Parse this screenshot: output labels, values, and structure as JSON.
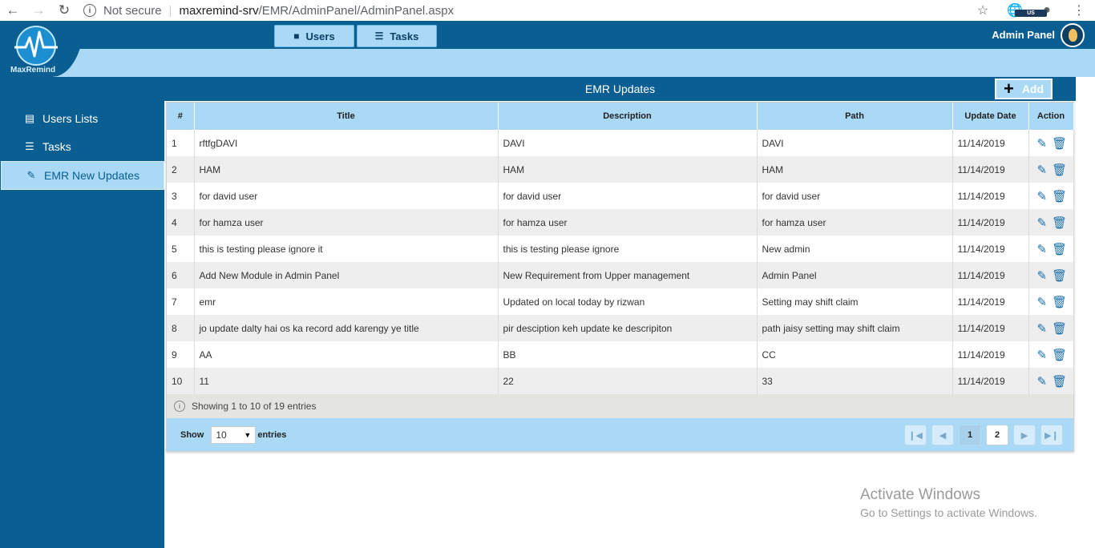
{
  "browser": {
    "security": "Not secure",
    "url_host": "maxremind-srv",
    "url_path": "/EMR/AdminPanel/AdminPanel.aspx",
    "ext_badge": "US"
  },
  "header": {
    "logo_text": "MaxRemind",
    "nav": [
      {
        "label": "Users",
        "icon": "user-icon"
      },
      {
        "label": "Tasks",
        "icon": "tasks-icon"
      }
    ],
    "admin_label": "Admin Panel"
  },
  "sidebar": {
    "items": [
      {
        "label": "Users Lists",
        "icon": "list-icon",
        "active": false
      },
      {
        "label": "Tasks",
        "icon": "tasks-icon",
        "active": false
      },
      {
        "label": "EMR New Updates",
        "icon": "edit-icon",
        "active": true
      }
    ]
  },
  "panel": {
    "title": "EMR Updates",
    "add_label": "Add"
  },
  "table": {
    "columns": [
      "#",
      "Title",
      "Description",
      "Path",
      "Update Date",
      "Action"
    ],
    "rows": [
      [
        "1",
        "rftfgDAVI",
        "DAVI",
        "DAVI",
        "11/14/2019"
      ],
      [
        "2",
        "HAM",
        "HAM",
        "HAM",
        "11/14/2019"
      ],
      [
        "3",
        "for david user",
        "for david user",
        "for david user",
        "11/14/2019"
      ],
      [
        "4",
        "for hamza user",
        "for hamza user",
        "for hamza user",
        "11/14/2019"
      ],
      [
        "5",
        "this is testing please ignore it",
        "this is testing please ignore",
        "New admin",
        "11/14/2019"
      ],
      [
        "6",
        "Add New Module in Admin Panel",
        "New Requirement from Upper management",
        "Admin Panel",
        "11/14/2019"
      ],
      [
        "7",
        "emr",
        "Updated on local today by rizwan",
        "Setting may shift claim",
        "11/14/2019"
      ],
      [
        "8",
        "jo update dalty hai os ka record add karengy ye title",
        "pir desciption keh update ke descripiton",
        "path jaisy setting may shift claim",
        "11/14/2019"
      ],
      [
        "9",
        "AA",
        "BB",
        "CC",
        "11/14/2019"
      ],
      [
        "10",
        "11",
        "22",
        "33",
        "11/14/2019"
      ]
    ],
    "info": "Showing 1 to 10 of 19 entries",
    "show_label": "Show",
    "page_size": "10",
    "entries_label": "entries",
    "pages": [
      "1",
      "2"
    ],
    "current_page": "1"
  },
  "watermark": {
    "line1": "Activate Windows",
    "line2": "Go to Settings to activate Windows."
  },
  "colors": {
    "brand_dark": "#0b5e91",
    "brand_light": "#a9d9f5"
  }
}
